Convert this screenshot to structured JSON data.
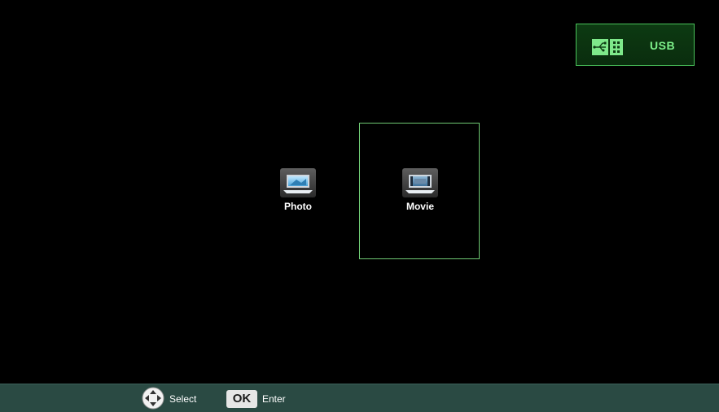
{
  "source": {
    "label": "USB",
    "icon": "usb-icon",
    "accent_color": "#49c25a",
    "label_color": "#7df08a"
  },
  "media": {
    "items": [
      {
        "label": "Photo",
        "icon": "photo-icon",
        "selected": false
      },
      {
        "label": "Movie",
        "icon": "movie-icon",
        "selected": true
      }
    ],
    "focus_color": "#6ec873"
  },
  "hints": {
    "select_icon": "dpad-icon",
    "select_label": "Select",
    "ok_key_label": "OK",
    "enter_label": "Enter",
    "bar_color": "#2a4a43"
  }
}
